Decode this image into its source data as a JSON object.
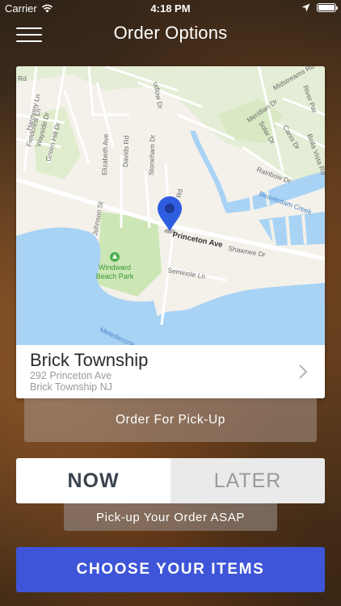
{
  "status_bar": {
    "carrier": "Carrier",
    "time": "4:18 PM",
    "battery_level": 1.0
  },
  "nav": {
    "title": "Order Options",
    "menu_icon": "hamburger-menu-icon"
  },
  "map": {
    "labels": {
      "harmony": "Harmony Ln",
      "fieldcrest": "Fieldcrest Ln",
      "wayside": "Wayside Dr",
      "green_hill": "Green Hill Dr",
      "rd_topleft": "Rd",
      "ludlow": "udlow Dr",
      "midstreams": "Midstreams Rd",
      "meridian": "Meridian Dr",
      "river": "River Par",
      "solar": "Solar Dr",
      "canis": "Canis Dr",
      "bella_vista": "Bella Vista Rd",
      "rainbow": "Rainbow Dr",
      "beaverdam": "Beaverdam Creek",
      "davids": "Davids Rd",
      "stoneham": "Stoneham Dr",
      "elizabeth": "Elizabeth Ave",
      "johnson": "Johnson St",
      "rd_pin": "Rd",
      "princeton": "Princeton Ave",
      "shawnee": "Shawnee Dr",
      "seminole": "Seminole Ln",
      "park_line1": "Windward",
      "park_line2": "Beach Park",
      "metedeconk": "Metedeconk"
    },
    "pin_icon": "map-pin-icon",
    "park_icon": "park-icon"
  },
  "location": {
    "name": "Brick Township",
    "address_line1": "292 Princeton Ave",
    "address_line2": "Brick Township NJ"
  },
  "order_type_label": "Order For Pick-Up",
  "timing": {
    "now_label": "NOW",
    "later_label": "LATER",
    "selected": "NOW"
  },
  "asap_note": "Pick-up Your Order ASAP",
  "choose_items_label": "CHOOSE YOUR ITEMS",
  "colors": {
    "accent": "#3e55d8",
    "map_water": "#a9d3f5",
    "map_land": "#f4f1ea",
    "map_green": "#cde6b5",
    "pin": "#2f5de0"
  }
}
